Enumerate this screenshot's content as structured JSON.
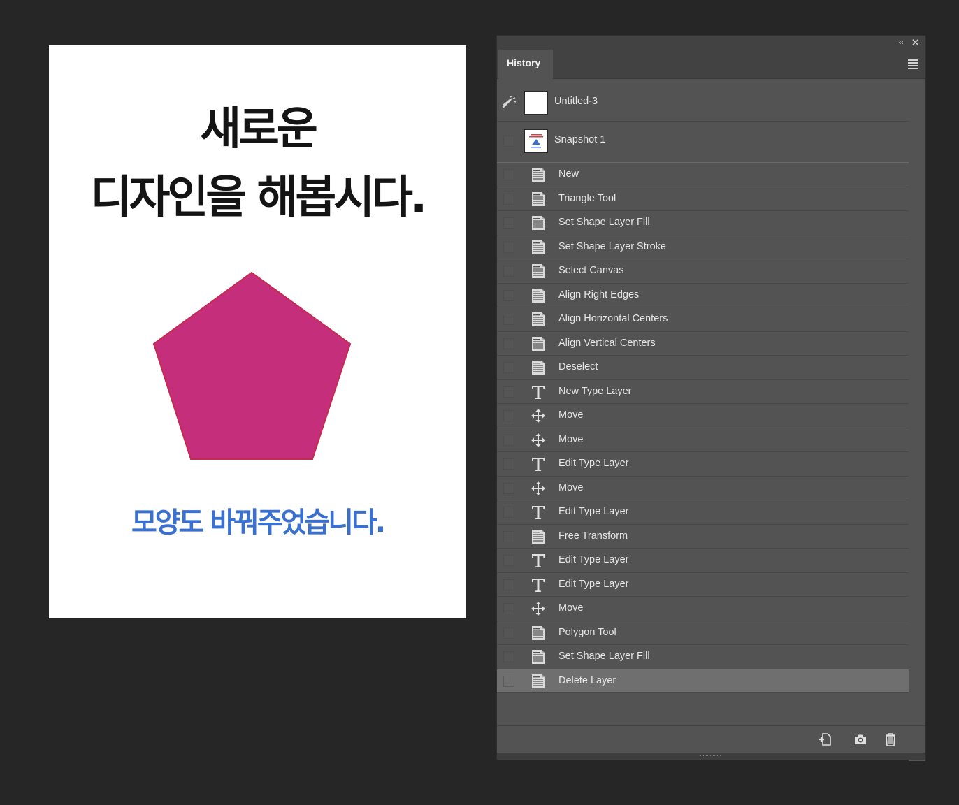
{
  "document": {
    "headline_line1": "새로운",
    "headline_line2": "디자인을 해봅시다.",
    "subline": "모양도 바꿔주었습니다.",
    "shape_fill": "#c42e7a",
    "shape_stroke": "#c52a4e",
    "subline_color": "#3a70d0"
  },
  "panel": {
    "tab_label": "History",
    "collapse_icon": "double-chevron-left-icon",
    "close_icon": "close-icon",
    "menu_icon": "hamburger-menu-icon"
  },
  "snapshots": [
    {
      "label": "Untitled-3"
    },
    {
      "label": "Snapshot 1"
    }
  ],
  "history": [
    {
      "label": "New",
      "icon": "document-icon"
    },
    {
      "label": "Triangle Tool",
      "icon": "document-icon"
    },
    {
      "label": "Set Shape Layer Fill",
      "icon": "document-icon"
    },
    {
      "label": "Set Shape Layer Stroke",
      "icon": "document-icon"
    },
    {
      "label": "Select Canvas",
      "icon": "document-icon"
    },
    {
      "label": "Align Right Edges",
      "icon": "document-icon"
    },
    {
      "label": "Align Horizontal Centers",
      "icon": "document-icon"
    },
    {
      "label": "Align Vertical Centers",
      "icon": "document-icon"
    },
    {
      "label": "Deselect",
      "icon": "document-icon"
    },
    {
      "label": "New Type Layer",
      "icon": "type-icon"
    },
    {
      "label": "Move",
      "icon": "move-icon"
    },
    {
      "label": "Move",
      "icon": "move-icon"
    },
    {
      "label": "Edit Type Layer",
      "icon": "type-icon"
    },
    {
      "label": "Move",
      "icon": "move-icon"
    },
    {
      "label": "Edit Type Layer",
      "icon": "type-icon"
    },
    {
      "label": "Free Transform",
      "icon": "document-icon"
    },
    {
      "label": "Edit Type Layer",
      "icon": "type-icon"
    },
    {
      "label": "Edit Type Layer",
      "icon": "type-icon"
    },
    {
      "label": "Move",
      "icon": "move-icon"
    },
    {
      "label": "Polygon Tool",
      "icon": "document-icon"
    },
    {
      "label": "Set Shape Layer Fill",
      "icon": "document-icon"
    },
    {
      "label": "Delete Layer",
      "icon": "document-icon",
      "selected": true
    }
  ],
  "footer": {
    "buttons": [
      "new-document-from-state-icon",
      "camera-icon",
      "trash-icon"
    ]
  }
}
